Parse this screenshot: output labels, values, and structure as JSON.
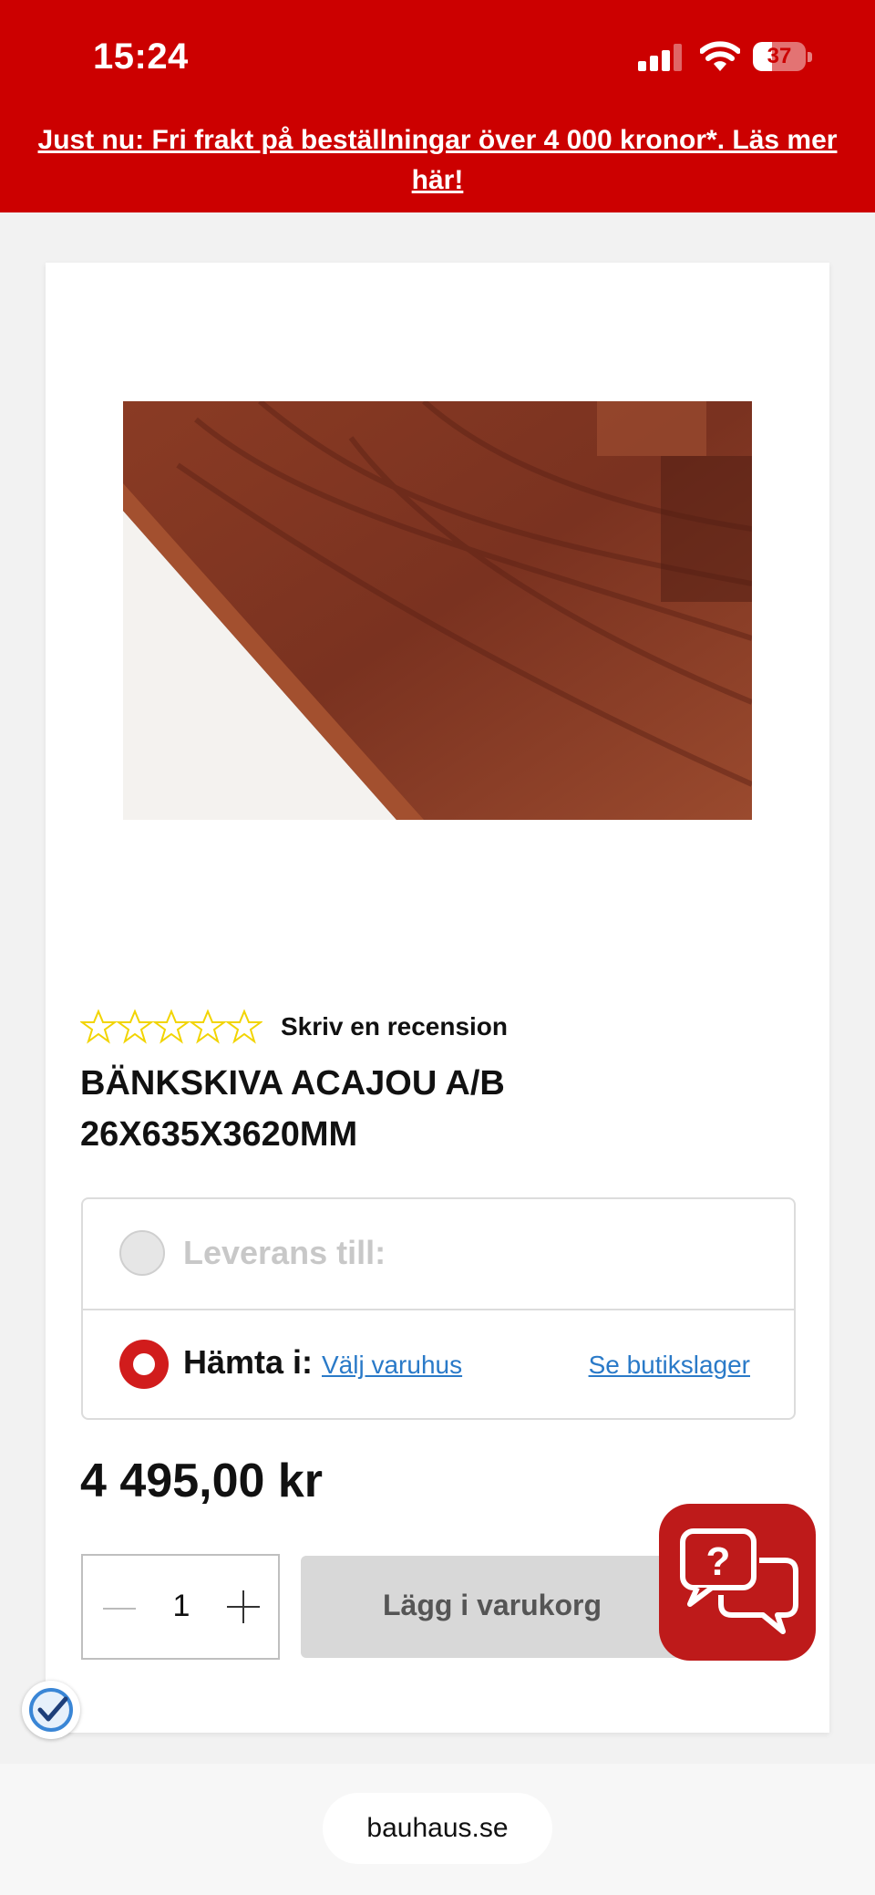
{
  "status_bar": {
    "time": "15:24",
    "battery": "37",
    "battery_level": 0.37
  },
  "promo": {
    "text": "Just nu: Fri frakt på beställningar över 4 000 kronor*. Läs mer här!"
  },
  "product": {
    "image_icon": "wood-countertop-image",
    "rating": {
      "stars_filled": 0,
      "stars_total": 5,
      "star_color": "#f2d400"
    },
    "review_link": "Skriv en recension",
    "title_line1": "BÄNKSKIVA ACAJOU A/B",
    "title_line2": "26X635X3620MM",
    "price": "4 495,00 kr"
  },
  "delivery": {
    "option1": {
      "label": "Leverans till:",
      "selected": false
    },
    "option2": {
      "label": "Hämta i:",
      "selected": true,
      "store_link": "Välj varuhus",
      "stock_link": "Se butikslager"
    }
  },
  "cart": {
    "quantity": "1",
    "add_button": "Lägg i varukorg"
  },
  "chat": {
    "icon": "chat-help-icon"
  },
  "browser": {
    "url": "bauhaus.se"
  },
  "colors": {
    "brand_red": "#cc0000",
    "link_blue": "#2a7ac8",
    "chat_red": "#be1a1a"
  }
}
